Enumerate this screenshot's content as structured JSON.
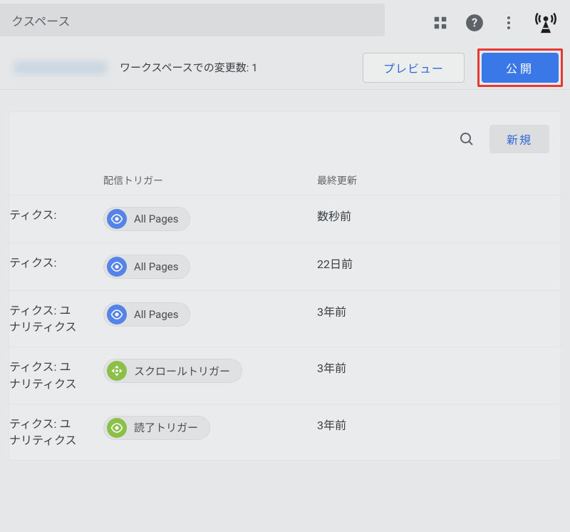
{
  "search": {
    "value": "クスペース"
  },
  "actionbar": {
    "workspace_changes": "ワークスペースでの変更数: 1",
    "preview": "プレビュー",
    "publish": "公開"
  },
  "card": {
    "new_label": "新規",
    "headers": {
      "trigger": "配信トリガー",
      "updated": "最終更新"
    },
    "rows": [
      {
        "name": "ティクス:",
        "trigger": {
          "label": "All Pages",
          "kind": "pageview"
        },
        "updated": "数秒前"
      },
      {
        "name": "ティクス:",
        "trigger": {
          "label": "All Pages",
          "kind": "pageview"
        },
        "updated": "22日前"
      },
      {
        "name": "ティクス: ユ\nナリティクス",
        "trigger": {
          "label": "All Pages",
          "kind": "pageview"
        },
        "updated": "3年前"
      },
      {
        "name": "ティクス: ユ\nナリティクス",
        "trigger": {
          "label": "スクロールトリガー",
          "kind": "scroll"
        },
        "updated": "3年前"
      },
      {
        "name": "ティクス: ユ\nナリティクス",
        "trigger": {
          "label": "読了トリガー",
          "kind": "custom"
        },
        "updated": "3年前"
      }
    ]
  }
}
